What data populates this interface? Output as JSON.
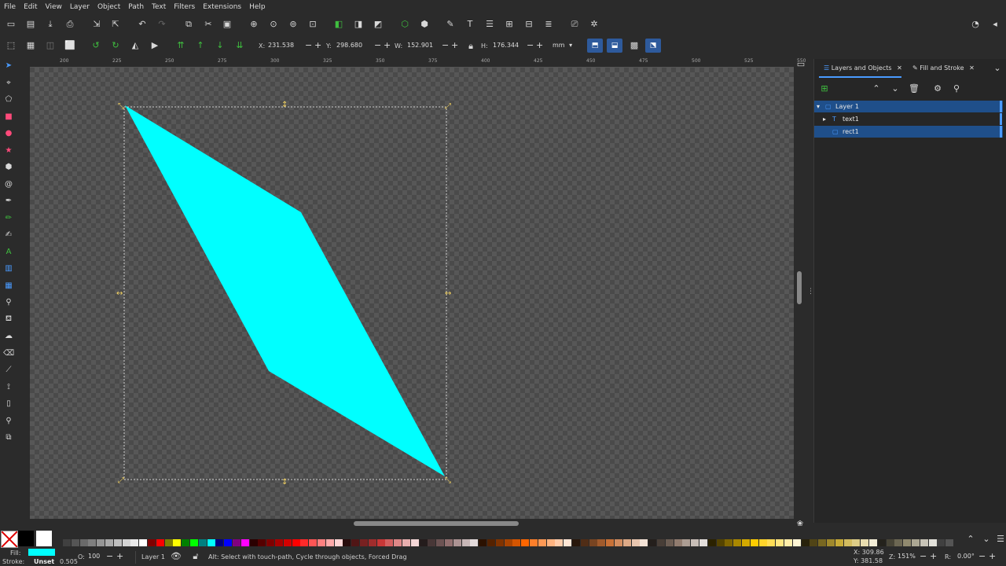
{
  "menu": [
    "File",
    "Edit",
    "View",
    "Layer",
    "Object",
    "Path",
    "Text",
    "Filters",
    "Extensions",
    "Help"
  ],
  "icons": {
    "new": "new-document-icon",
    "open": "open-folder-icon",
    "save": "save-icon",
    "print": "print-icon",
    "undo": "undo-icon",
    "redo": "redo-icon",
    "copy": "copy-icon",
    "cut": "cut-icon",
    "paste": "paste-icon"
  },
  "controls": {
    "x_label": "X:",
    "x_value": "231.538",
    "y_label": "Y:",
    "y_value": "298.680",
    "w_label": "W:",
    "w_value": "152.901",
    "h_label": "H:",
    "h_value": "176.344",
    "unit": "mm"
  },
  "rulers": {
    "h_ticks": [
      "200",
      "225",
      "250",
      "275",
      "300",
      "325",
      "350",
      "375",
      "400",
      "425",
      "450",
      "475",
      "500",
      "525",
      "550"
    ]
  },
  "dock": {
    "tabs": [
      "Layers and Objects",
      "Fill and Stroke"
    ],
    "rows": [
      {
        "label": "Layer 1",
        "expander": "▾",
        "selected": true
      },
      {
        "label": "text1",
        "expander": "▸",
        "selected": false
      },
      {
        "label": "rect1",
        "expander": "",
        "selected": true
      }
    ]
  },
  "status": {
    "fill_label": "Fill:",
    "stroke_label": "Stroke:",
    "stroke_value": "Unset",
    "stroke_width": "0.505",
    "opacity_label": "O:",
    "opacity_value": "100",
    "layer_name": "Layer 1",
    "message": "Alt: Select with touch-path, Cycle through objects, Forced Drag",
    "cursor_x": "X: 309.86",
    "cursor_y": "Y: 381.58",
    "zoom_label": "Z:",
    "zoom_value": "151%",
    "rotation_label": "R:",
    "rotation_value": "0.00°"
  },
  "colors": {
    "shape_fill": "#00ffff",
    "selection_accent": "#1f4f8a",
    "handle": "#f0d060"
  }
}
